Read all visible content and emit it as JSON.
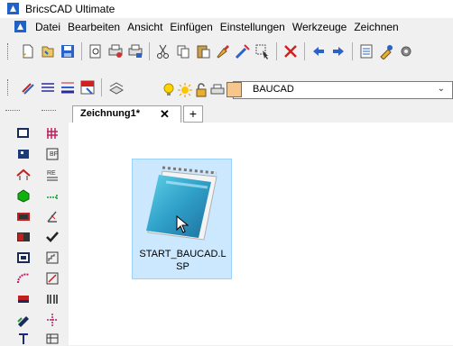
{
  "window": {
    "title": "BricsCAD Ultimate"
  },
  "menu": {
    "items": [
      "Datei",
      "Bearbeiten",
      "Ansicht",
      "Einfügen",
      "Einstellungen",
      "Werkzeuge",
      "Zeichnen"
    ]
  },
  "layer": {
    "current": "BAUCAD",
    "color": "#f7c58e"
  },
  "tabs": [
    {
      "label": "Zeichnung1*"
    }
  ],
  "desktop_file": {
    "name_line1": "START_BAUCAD.L",
    "name_line2": "SP"
  },
  "colors": {
    "accent": "#1f62c8",
    "selection": "#cce8ff",
    "selection_border": "#99d1ff"
  }
}
